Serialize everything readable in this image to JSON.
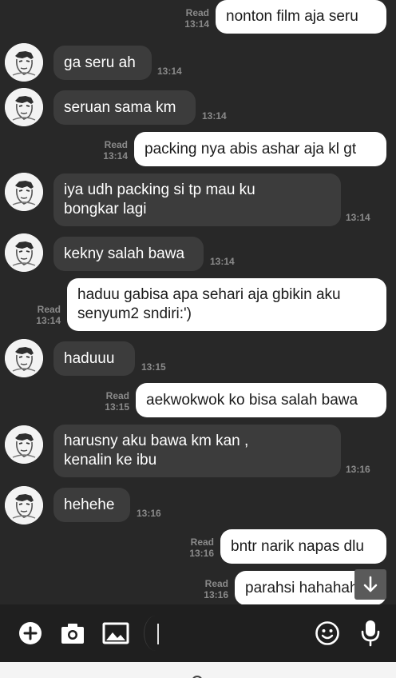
{
  "messages": [
    {
      "dir": "out",
      "text": "nonton film aja seru",
      "read": "Read",
      "time": "13:14"
    },
    {
      "dir": "in",
      "text": "ga seru ah",
      "time": "13:14"
    },
    {
      "dir": "in",
      "text": "seruan sama km",
      "time": "13:14"
    },
    {
      "dir": "out",
      "text": "packing nya abis ashar aja kl gt",
      "read": "Read",
      "time": "13:14"
    },
    {
      "dir": "in",
      "text": "iya udh packing si tp mau ku bongkar lagi",
      "time": "13:14"
    },
    {
      "dir": "in",
      "text": "kekny salah bawa",
      "time": "13:14"
    },
    {
      "dir": "out",
      "text": "haduu gabisa apa sehari aja gbikin aku senyum2 sndiri:')",
      "read": "Read",
      "time": "13:14"
    },
    {
      "dir": "in",
      "text": "haduuu",
      "time": "13:15"
    },
    {
      "dir": "out",
      "text": "aekwokwok ko bisa salah bawa",
      "read": "Read",
      "time": "13:15"
    },
    {
      "dir": "in",
      "text": "harusny aku bawa km kan , kenalin ke ibu",
      "time": "13:16"
    },
    {
      "dir": "in",
      "text": "hehehe",
      "time": "13:16"
    },
    {
      "dir": "out",
      "text": "bntr narik napas dlu",
      "read": "Read",
      "time": "13:16"
    },
    {
      "dir": "out",
      "text": "parahsi hahahaha",
      "read": "Read",
      "time": "13:16"
    }
  ],
  "icons": {
    "scroll_down": "arrow-down-icon",
    "add": "plus-circle-icon",
    "camera": "camera-icon",
    "gallery": "image-icon",
    "emoji": "smiley-icon",
    "mic": "microphone-icon"
  },
  "colors": {
    "background": "#282828",
    "incoming_bubble": "#3c3c3c",
    "outgoing_bubble": "#ffffff",
    "meta_text": "#8a8a8a"
  },
  "input": {
    "value": ""
  }
}
